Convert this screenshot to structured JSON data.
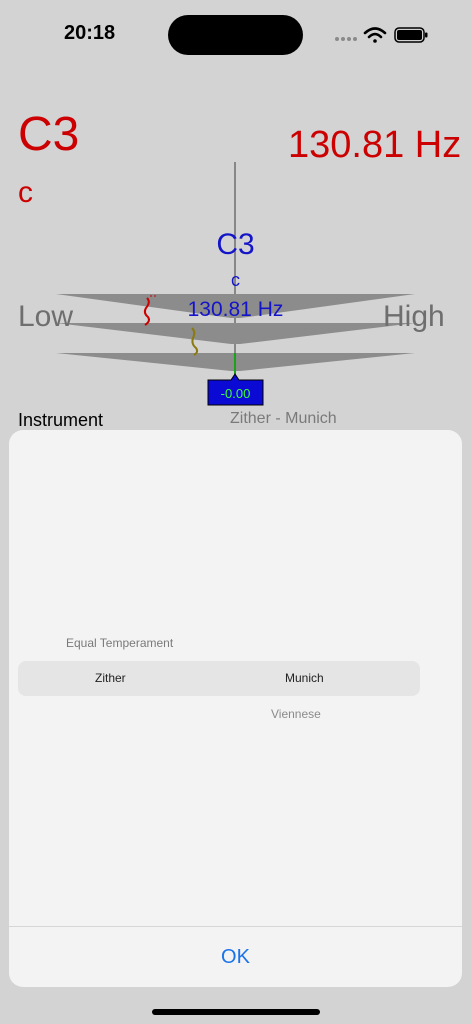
{
  "status_bar": {
    "time": "20:18"
  },
  "reading": {
    "note": "C3",
    "note_name": "c",
    "frequency": "130.81 Hz"
  },
  "tuner": {
    "note": "C3",
    "note_name": "c",
    "frequency": "130.81 Hz",
    "low_label": "Low",
    "high_label": "High",
    "deviation": "-0.00"
  },
  "instrument": {
    "label": "Instrument",
    "value": "Zither - Munich"
  },
  "picker": {
    "above_option": "Equal Temperament",
    "selected_instrument": "Zither",
    "selected_tuning": "Munich",
    "below_option": "Viennese"
  },
  "dialog": {
    "ok_label": "OK"
  },
  "colors": {
    "reading_red": "#cc0000",
    "tuner_blue": "#1414c8",
    "accent_blue": "#1a73e8"
  }
}
